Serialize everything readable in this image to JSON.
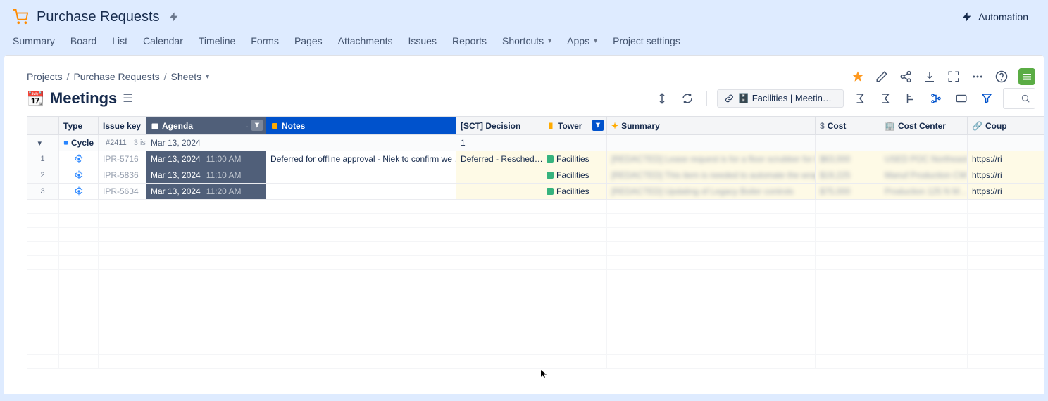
{
  "header": {
    "project_title": "Purchase Requests",
    "automation_label": "Automation"
  },
  "nav": {
    "summary": "Summary",
    "board": "Board",
    "list": "List",
    "calendar": "Calendar",
    "timeline": "Timeline",
    "forms": "Forms",
    "pages": "Pages",
    "attachments": "Attachments",
    "issues": "Issues",
    "reports": "Reports",
    "shortcuts": "Shortcuts",
    "apps": "Apps",
    "project_settings": "Project settings"
  },
  "breadcrumb": {
    "projects": "Projects",
    "project": "Purchase Requests",
    "sheets": "Sheets"
  },
  "sheet": {
    "emoji": "📆",
    "title": "Meetings",
    "view_chip": "🗄️ Facilities | Meeting | …"
  },
  "columns": {
    "type": "Type",
    "issue_key": "Issue key",
    "agenda": "Agenda",
    "notes": "Notes",
    "decision": "[SCT] Decision",
    "tower": "Tower",
    "summary": "Summary",
    "cost": "Cost",
    "cost_center": "Cost Center",
    "coupa": "Coup"
  },
  "group": {
    "label": "Cycle",
    "issue_key": "#2411",
    "count": "3 is",
    "agenda_date": "Mar 13, 2024",
    "decision_count": "1"
  },
  "rows": [
    {
      "num": "1",
      "key": "IPR-5716",
      "agenda_date": "Mar 13, 2024",
      "agenda_time": "11:00 AM",
      "notes": "Deferred for offline approval - Niek to confirm we …",
      "decision": "Deferred - Resched…",
      "tower": "Facilities",
      "summary": "[REDACTED] Lease request is for a floor scrubber for the …",
      "cost": "$63,000",
      "cost_center": "USED POC Northeast",
      "coupa": "https://ri"
    },
    {
      "num": "2",
      "key": "IPR-5836",
      "agenda_date": "Mar 13, 2024",
      "agenda_time": "11:10 AM",
      "notes": "",
      "decision": "",
      "tower": "Facilities",
      "summary": "[REDACTED] This item is needed to automate the wrapper…",
      "cost": "$19,225",
      "cost_center": "Manuf Production CW",
      "coupa": "https://ri"
    },
    {
      "num": "3",
      "key": "IPR-5634",
      "agenda_date": "Mar 13, 2024",
      "agenda_time": "11:20 AM",
      "notes": "",
      "decision": "",
      "tower": "Facilities",
      "summary": "[REDACTED] Updating of Legacy Boiler controls",
      "cost": "$75,000",
      "cost_center": "Production 125 N M…",
      "coupa": "https://ri"
    }
  ]
}
